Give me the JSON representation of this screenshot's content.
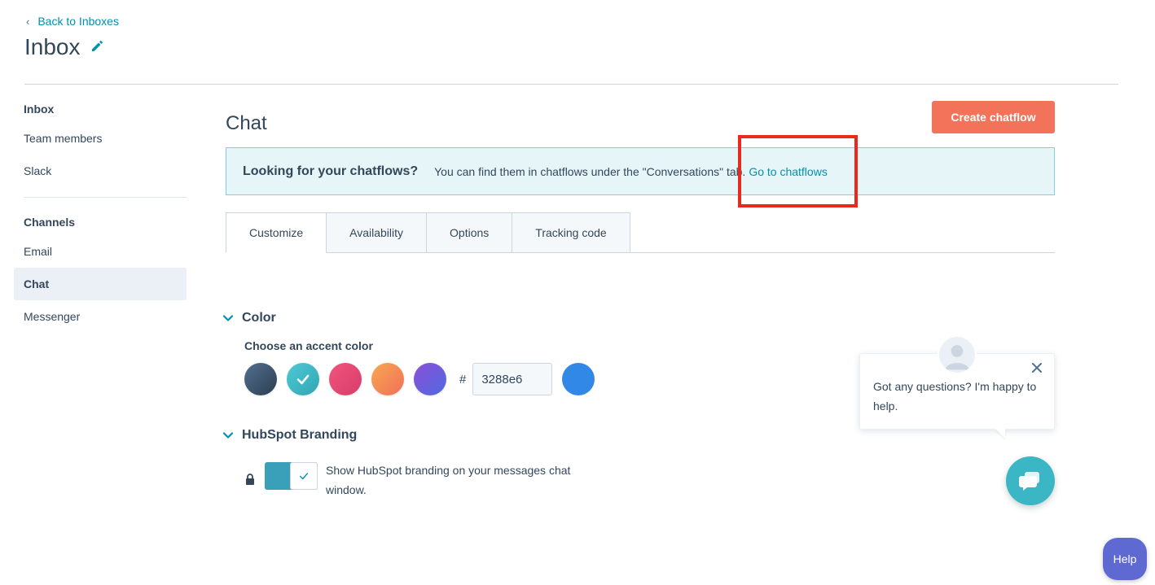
{
  "header": {
    "back_label": "Back to Inboxes",
    "title": "Inbox"
  },
  "sidebar": {
    "section1_heading": "Inbox",
    "section1_items": [
      "Team members",
      "Slack"
    ],
    "section2_heading": "Channels",
    "section2_items": [
      "Email",
      "Chat",
      "Messenger"
    ],
    "active_item": "Chat"
  },
  "main": {
    "title": "Chat",
    "create_button": "Create chatflow",
    "banner": {
      "lead": "Looking for your chatflows?",
      "text": "You can find them in chatflows under the \"Conversations\" tab.",
      "link": "Go to chatflows"
    },
    "tabs": [
      "Customize",
      "Availability",
      "Options",
      "Tracking code"
    ],
    "active_tab": "Customize",
    "color_section": {
      "heading": "Color",
      "label": "Choose an accent color",
      "swatches": [
        "#425b76",
        "#3ab6c4",
        "#e8475f",
        "#f5894f",
        "#7b4fd8"
      ],
      "selected_swatch_index": 1,
      "hash": "#",
      "hex_value": "3288e6",
      "preview_color": "#3288e6"
    },
    "branding_section": {
      "heading": "HubSpot Branding",
      "toggle_label": "Show HubSpot branding on your messages chat window.",
      "toggle_on": true
    }
  },
  "chat_widget": {
    "message": "Got any questions? I'm happy to help.",
    "launcher_color": "#3ab6c4"
  },
  "help_button": "Help",
  "colors": {
    "link": "#0091ae",
    "primary_button": "#f2735a",
    "highlight_box": "#e8291c",
    "help": "#5e6ad2"
  }
}
